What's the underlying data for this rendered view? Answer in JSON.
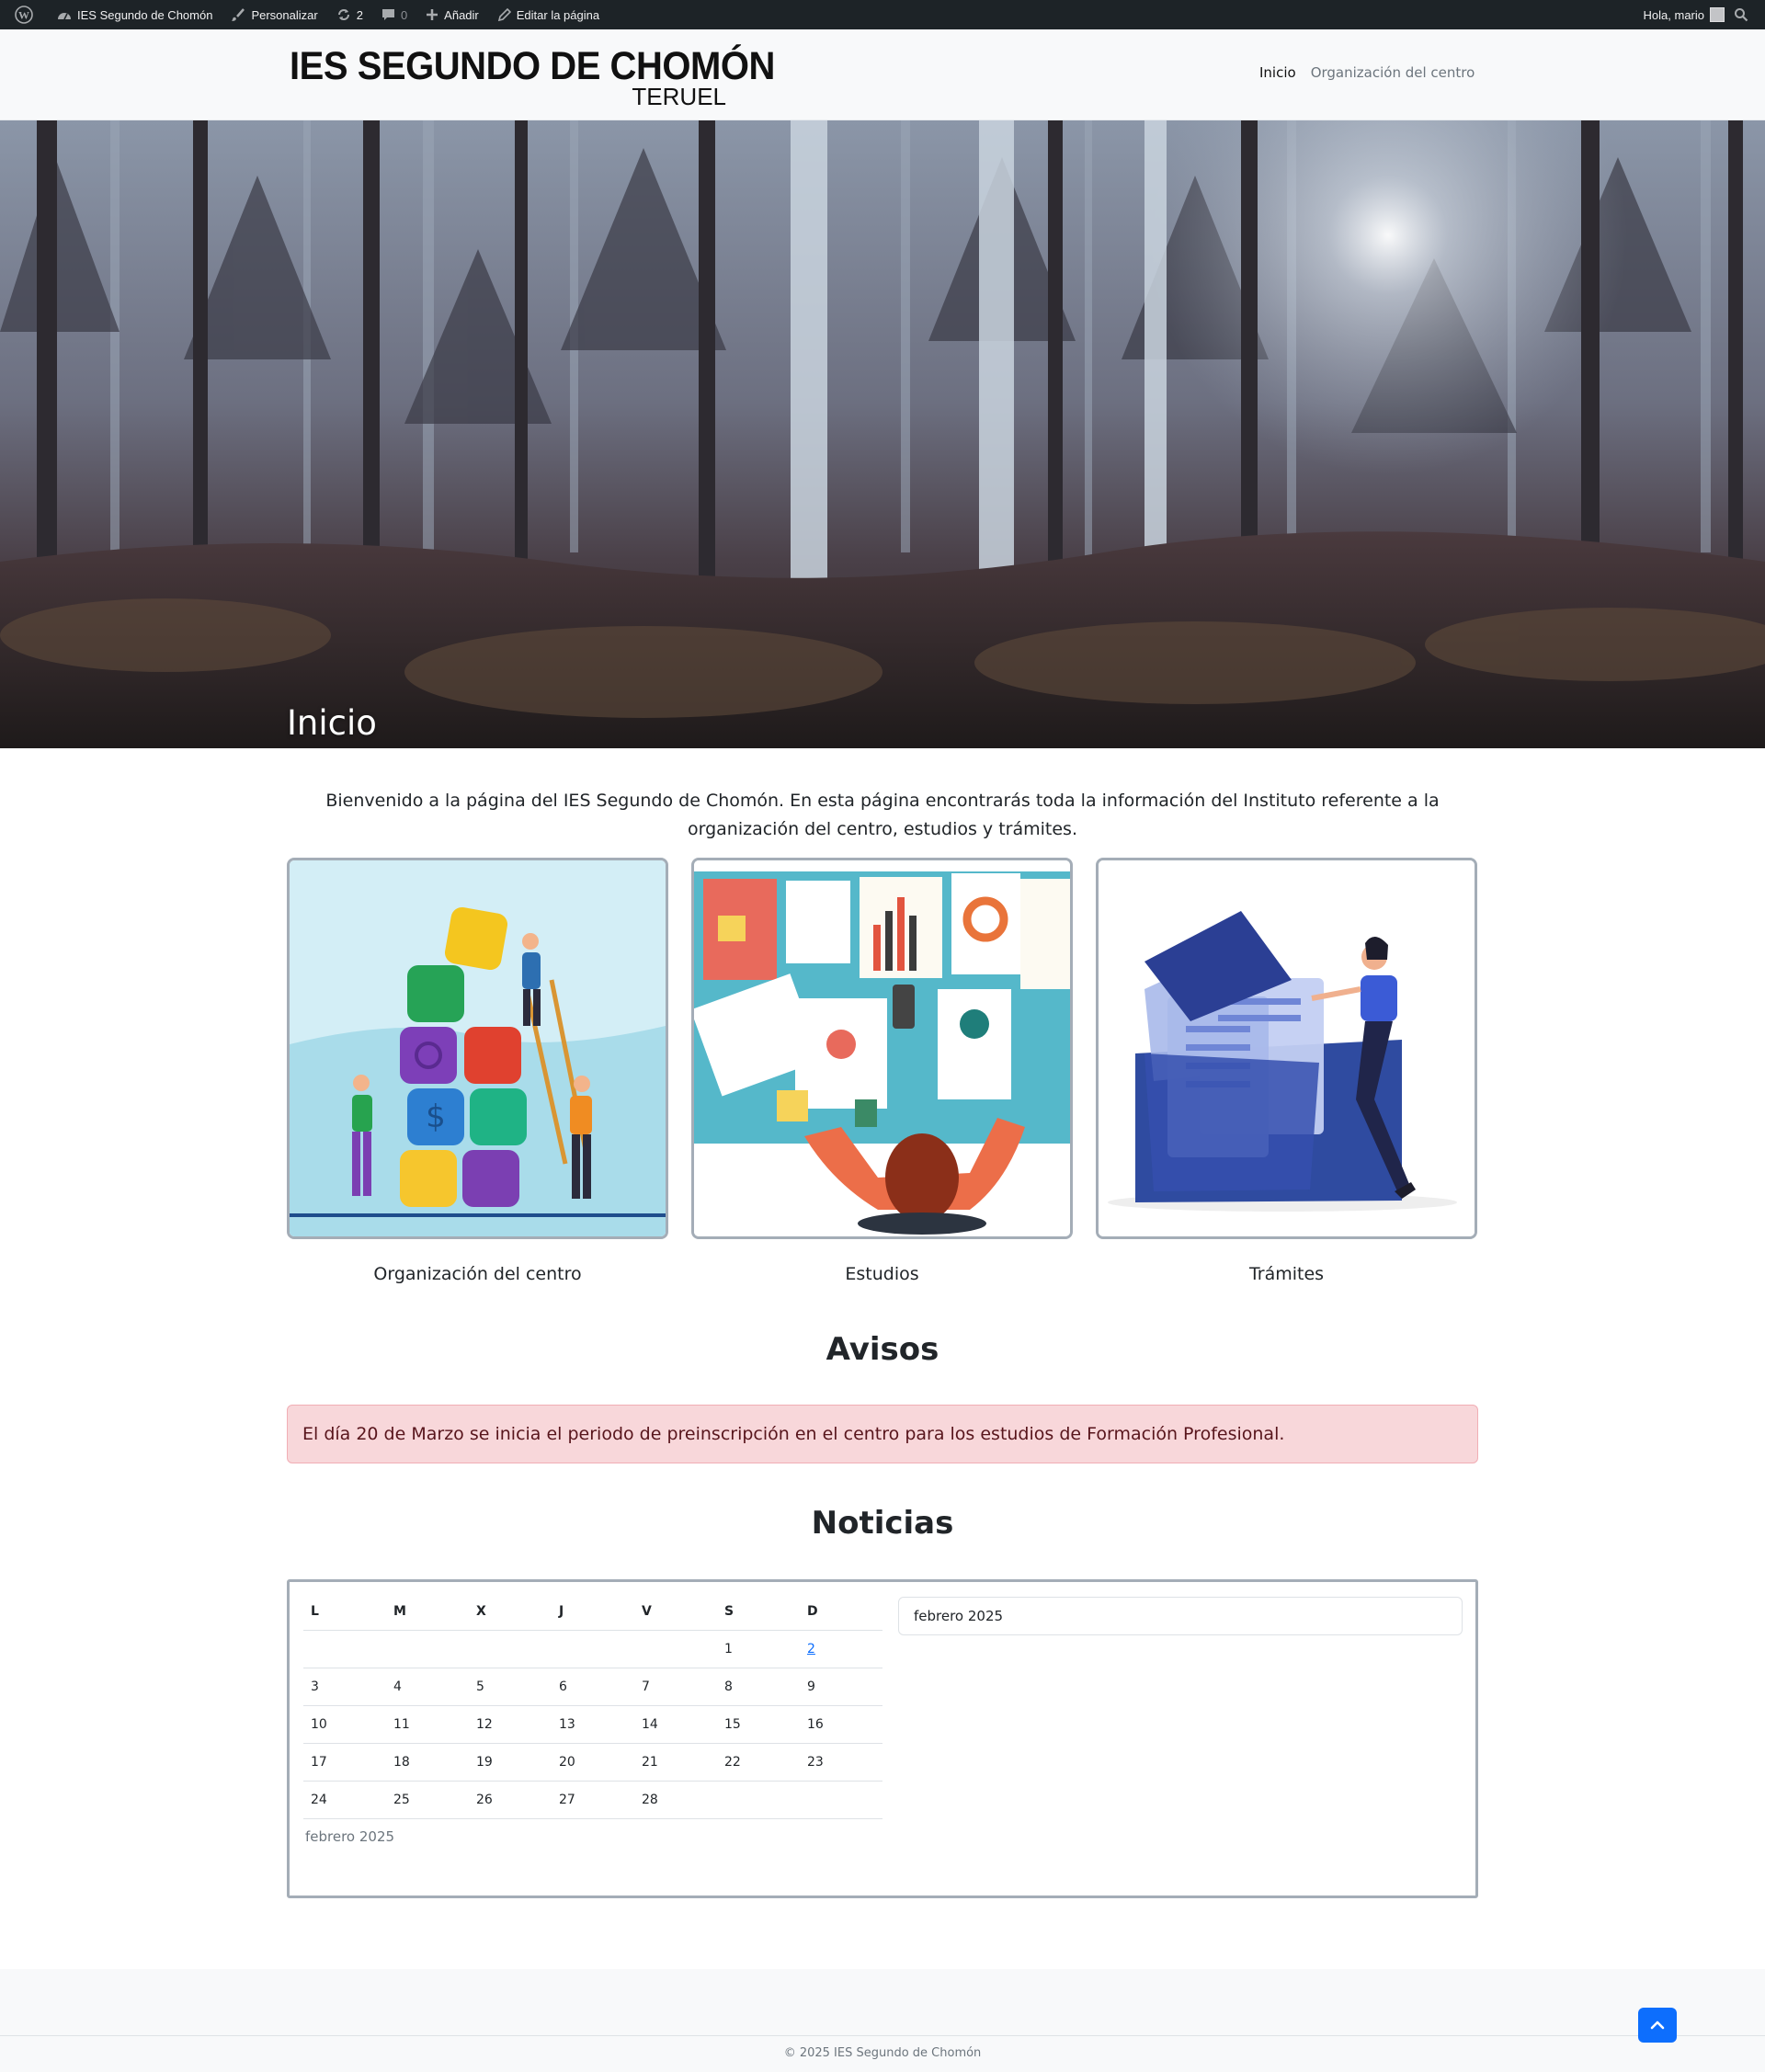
{
  "admin_bar": {
    "site_name": "IES Segundo de Chomón",
    "customize": "Personalizar",
    "updates_count": "2",
    "comments_count": "0",
    "add_new": "Añadir",
    "edit_page": "Editar la página",
    "greeting": "Hola, mario"
  },
  "header": {
    "brand_name": "IES SEGUNDO DE CHOMÓN",
    "brand_sub": "TERUEL",
    "nav": [
      "Inicio",
      "Organización del centro"
    ]
  },
  "hero": {
    "title": "Inicio"
  },
  "intro": "Bienvenido a la página del IES Segundo de Chomón. En esta página encontrarás toda la información del Instituto referente a la organización del centro, estudios y trámites.",
  "cards": [
    "Organización del centro",
    "Estudios",
    "Trámites"
  ],
  "avisos": {
    "title": "Avisos",
    "alert": "El día 20 de Marzo se inicia el periodo de preinscripción en el centro para los estudios de Formación Profesional."
  },
  "noticias": {
    "title": "Noticias",
    "weekdays": [
      "L",
      "M",
      "X",
      "J",
      "V",
      "S",
      "D"
    ],
    "weeks": [
      [
        "",
        "",
        "",
        "",
        "",
        "1",
        "2"
      ],
      [
        "3",
        "4",
        "5",
        "6",
        "7",
        "8",
        "9"
      ],
      [
        "10",
        "11",
        "12",
        "13",
        "14",
        "15",
        "16"
      ],
      [
        "17",
        "18",
        "19",
        "20",
        "21",
        "22",
        "23"
      ],
      [
        "24",
        "25",
        "26",
        "27",
        "28",
        "",
        ""
      ]
    ],
    "linked_day": "2",
    "caption": "febrero 2025",
    "month_select": "febrero 2025"
  },
  "footer": {
    "copyright": "© 2025 IES Segundo de Chomón"
  },
  "colors": {
    "admin_bar": "#1d2327",
    "alert_bg": "#f8d7da",
    "primary": "#0d6efd"
  }
}
